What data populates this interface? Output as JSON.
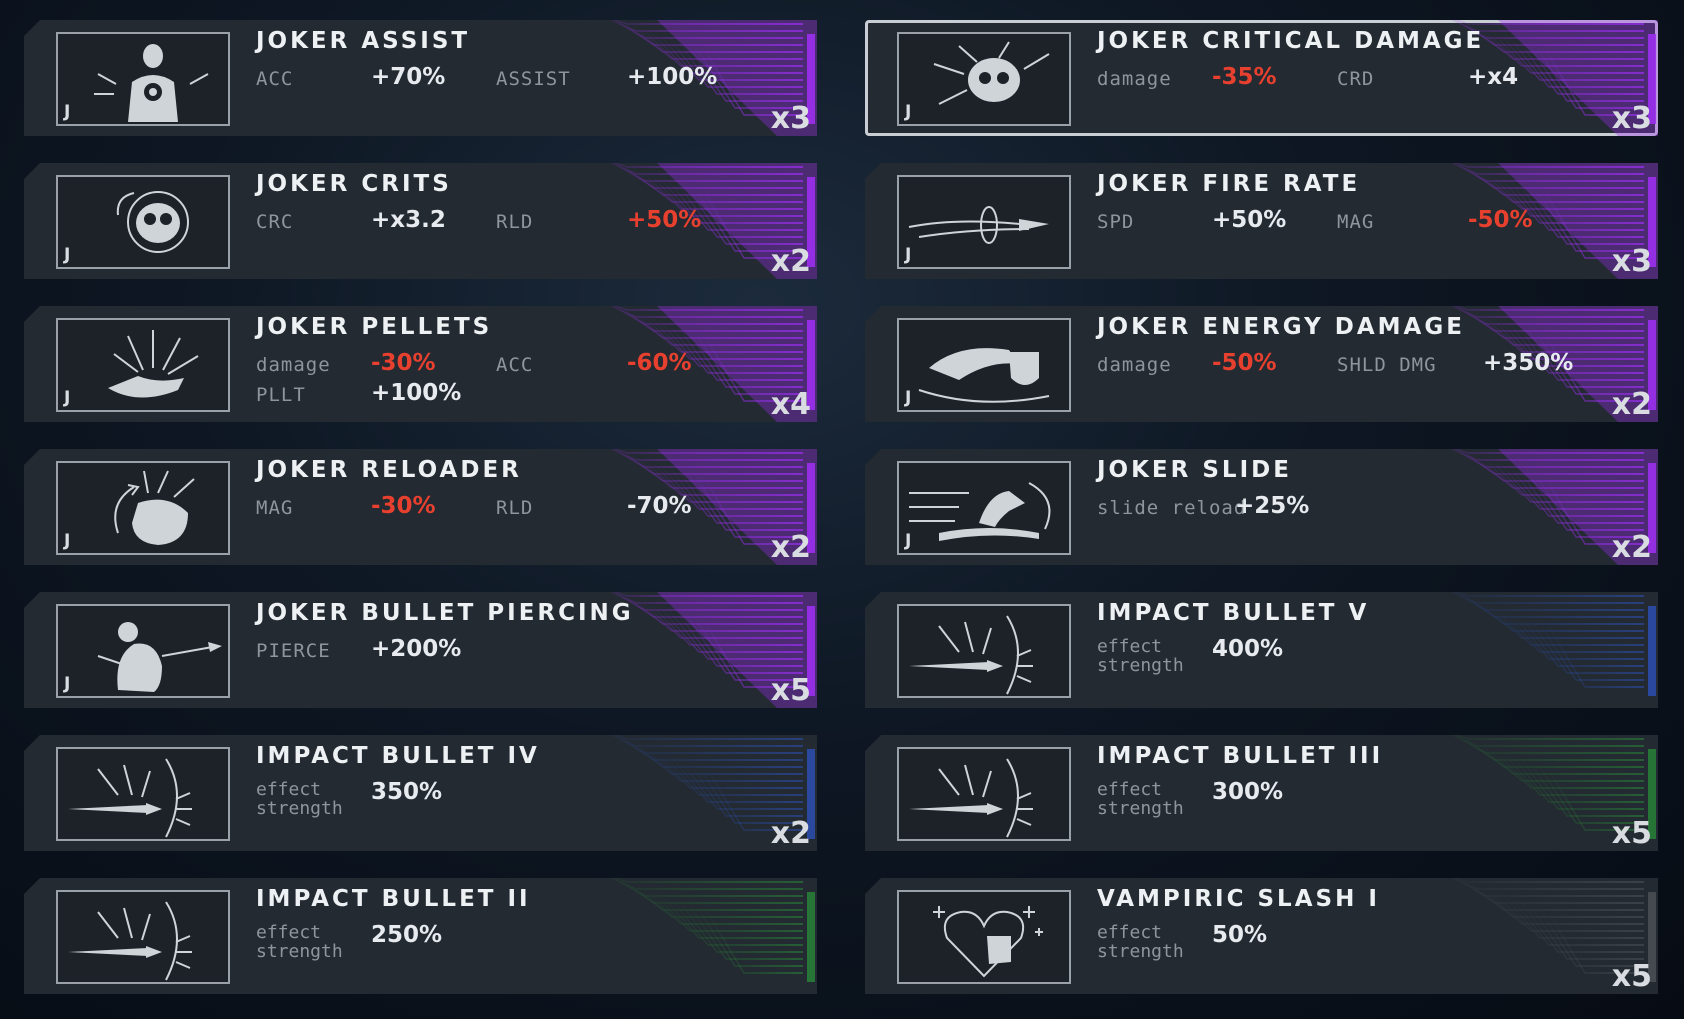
{
  "colors": {
    "joker": "#9b2ff0",
    "blue": "#2f5ee8",
    "green": "#2aa83a",
    "gray": "#5b6168",
    "negative": "#e8402f",
    "positive": "#e7ebef"
  },
  "cards": [
    {
      "title": "JOKER ASSIST",
      "icon": "target-man-icon",
      "tier": "J",
      "accent": "purple",
      "count": "x3",
      "stats": [
        {
          "label": "ACC",
          "value": "+70%",
          "neg": false
        },
        {
          "label": "ASSIST",
          "value": "+100%",
          "neg": false
        }
      ]
    },
    {
      "title": "JOKER CRITICAL DAMAGE",
      "icon": "exploding-skull-icon",
      "tier": "J",
      "accent": "purple",
      "count": "x3",
      "selected": true,
      "stats": [
        {
          "label": "damage",
          "value": "-35%",
          "neg": true
        },
        {
          "label": "CRD",
          "value": "+x4",
          "neg": false
        }
      ]
    },
    {
      "title": "JOKER CRITS",
      "icon": "skull-icon",
      "tier": "J",
      "accent": "purple",
      "count": "x2",
      "stats": [
        {
          "label": "CRC",
          "value": "+x3.2",
          "neg": false
        },
        {
          "label": "RLD",
          "value": "+50%",
          "neg": true
        }
      ]
    },
    {
      "title": "JOKER FIRE RATE",
      "icon": "bullet-trail-icon",
      "tier": "J",
      "accent": "purple",
      "count": "x3",
      "stats": [
        {
          "label": "SPD",
          "value": "+50%",
          "neg": false
        },
        {
          "label": "MAG",
          "value": "-50%",
          "neg": true
        }
      ]
    },
    {
      "title": "JOKER PELLETS",
      "icon": "exploding-hand-icon",
      "tier": "J",
      "accent": "purple",
      "count": "x4",
      "stats": [
        {
          "label": "damage",
          "value": "-30%",
          "neg": true
        },
        {
          "label": "ACC",
          "value": "-60%",
          "neg": true
        },
        {
          "label": "PLLT",
          "value": "+100%",
          "neg": false
        }
      ]
    },
    {
      "title": "JOKER ENERGY DAMAGE",
      "icon": "eagle-shield-icon",
      "tier": "J",
      "accent": "purple",
      "count": "x2",
      "stats": [
        {
          "label": "damage",
          "value": "-50%",
          "neg": true
        },
        {
          "label": "SHLD DMG",
          "value": "+350%",
          "neg": false
        }
      ]
    },
    {
      "title": "JOKER RELOADER",
      "icon": "reload-fist-icon",
      "tier": "J",
      "accent": "purple",
      "count": "x2",
      "stats": [
        {
          "label": "MAG",
          "value": "-30%",
          "neg": true
        },
        {
          "label": "RLD",
          "value": "-70%",
          "neg": false
        }
      ]
    },
    {
      "title": "JOKER SLIDE",
      "icon": "sliding-runner-icon",
      "tier": "J",
      "accent": "purple",
      "count": "x2",
      "stats": [
        {
          "label": "slide reload",
          "value": "+25%",
          "neg": false
        }
      ]
    },
    {
      "title": "JOKER BULLET PIERCING",
      "icon": "pierced-body-icon",
      "tier": "J",
      "accent": "purple",
      "count": "x5",
      "stats": [
        {
          "label": "PIERCE",
          "value": "+200%",
          "neg": false
        }
      ]
    },
    {
      "title": "IMPACT BULLET V",
      "icon": "impact-bullet-icon",
      "tier": "",
      "accent": "blue",
      "count": "",
      "stats": [
        {
          "label": "effect\nstrength",
          "value": "400%",
          "neg": false
        }
      ]
    },
    {
      "title": "IMPACT BULLET IV",
      "icon": "impact-bullet-icon",
      "tier": "",
      "accent": "blue",
      "count": "x2",
      "stats": [
        {
          "label": "effect\nstrength",
          "value": "350%",
          "neg": false
        }
      ]
    },
    {
      "title": "IMPACT BULLET III",
      "icon": "impact-bullet-icon",
      "tier": "",
      "accent": "green",
      "count": "x5",
      "stats": [
        {
          "label": "effect\nstrength",
          "value": "300%",
          "neg": false
        }
      ]
    },
    {
      "title": "IMPACT BULLET II",
      "icon": "impact-bullet-icon",
      "tier": "",
      "accent": "green",
      "count": "",
      "stats": [
        {
          "label": "effect\nstrength",
          "value": "250%",
          "neg": false
        }
      ]
    },
    {
      "title": "VAMPIRIC SLASH I",
      "icon": "heart-fist-icon",
      "tier": "",
      "accent": "gray",
      "count": "x5",
      "stats": [
        {
          "label": "effect\nstrength",
          "value": "50%",
          "neg": false
        }
      ]
    }
  ]
}
